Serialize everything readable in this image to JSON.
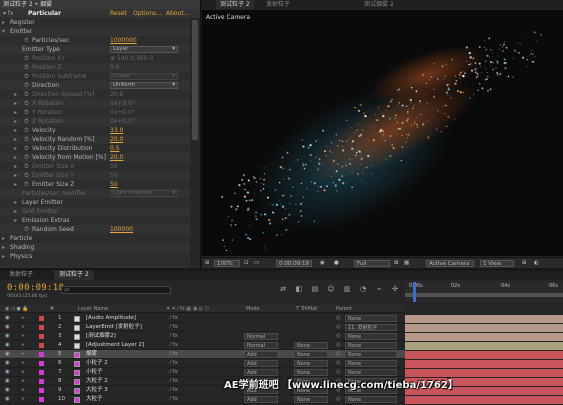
{
  "effect_controls": {
    "header": "测试粒子 2 • 烟雾",
    "effect_name": "Particular",
    "reset": "Reset",
    "options": "Options...",
    "about": "About...",
    "rows": [
      {
        "label": "Register",
        "indent": 1,
        "arrow": "▸"
      },
      {
        "label": "Emitter",
        "indent": 1,
        "arrow": "▾"
      },
      {
        "label": "Particles/sec",
        "indent": 2,
        "stopwatch": true,
        "value": "1000000"
      },
      {
        "label": "Emitter Type",
        "indent": 2,
        "dropdown": "Layer"
      },
      {
        "label": "Position XY",
        "indent": 2,
        "stopwatch": true,
        "value": "⊕ 540.0,360.0",
        "disabled": true
      },
      {
        "label": "Position Z",
        "indent": 2,
        "stopwatch": true,
        "value": "0.0",
        "disabled": true
      },
      {
        "label": "Position Subframe",
        "indent": 2,
        "stopwatch": true,
        "dropdown": "Linear",
        "disabled": true
      },
      {
        "label": "Direction",
        "indent": 2,
        "stopwatch": true,
        "dropdown": "Uniform"
      },
      {
        "label": "Direction Spread [%]",
        "indent": 2,
        "stopwatch": true,
        "arrow": "▸",
        "value": "20.0",
        "disabled": true
      },
      {
        "label": "X Rotation",
        "indent": 2,
        "stopwatch": true,
        "arrow": "▸",
        "value": "0x+0.0°",
        "disabled": true
      },
      {
        "label": "Y Rotation",
        "indent": 2,
        "stopwatch": true,
        "arrow": "▸",
        "value": "0x+0.0°",
        "disabled": true
      },
      {
        "label": "Z Rotation",
        "indent": 2,
        "stopwatch": true,
        "arrow": "▸",
        "value": "0x+0.0°",
        "disabled": true
      },
      {
        "label": "Velocity",
        "indent": 2,
        "stopwatch": true,
        "arrow": "▸",
        "value": "33.0"
      },
      {
        "label": "Velocity Random [%]",
        "indent": 2,
        "stopwatch": true,
        "arrow": "▸",
        "value": "20.0"
      },
      {
        "label": "Velocity Distribution",
        "indent": 2,
        "stopwatch": true,
        "arrow": "▸",
        "value": "0.5"
      },
      {
        "label": "Velocity from Motion [%]",
        "indent": 2,
        "stopwatch": true,
        "arrow": "▸",
        "value": "20.0"
      },
      {
        "label": "Emitter Size X",
        "indent": 2,
        "stopwatch": true,
        "arrow": "▸",
        "value": "50",
        "disabled": true
      },
      {
        "label": "Emitter Size Y",
        "indent": 2,
        "stopwatch": true,
        "arrow": "▸",
        "value": "50",
        "disabled": true
      },
      {
        "label": "Emitter Size Z",
        "indent": 2,
        "stopwatch": true,
        "arrow": "▸",
        "value": "50"
      },
      {
        "label": "Particles/sec modifier",
        "indent": 2,
        "dropdown": "Light Intensity",
        "disabled": true
      },
      {
        "label": "Layer Emitter",
        "indent": 2,
        "arrow": "▸"
      },
      {
        "label": "Grid Emitter",
        "indent": 2,
        "arrow": "▸",
        "disabled": true
      },
      {
        "label": "Emission Extras",
        "indent": 2,
        "arrow": "▸"
      },
      {
        "label": "Random Seed",
        "indent": 2,
        "stopwatch": true,
        "value": "100000"
      },
      {
        "label": "Particle",
        "indent": 1,
        "arrow": "▸"
      },
      {
        "label": "Shading",
        "indent": 1,
        "arrow": "▸"
      },
      {
        "label": "Physics",
        "indent": 1,
        "arrow": "▸"
      }
    ]
  },
  "viewer": {
    "tabs": [
      "测试粒子 2",
      "发射粒子",
      "测试烟雾 2"
    ],
    "camera_label": "Active Camera",
    "zoom": "100%",
    "timecode": "0:00:09:18",
    "resolution": "Full",
    "camera_select": "Active Camera",
    "view_select": "1 View"
  },
  "timeline": {
    "tabs": [
      "发射粒子",
      "测试粒子 2"
    ],
    "timecode": "0:00:09:18",
    "fps": "00243 (25.00 fps)",
    "search_placeholder": "ρ▾",
    "ruler_ticks": [
      "0:00s",
      "02s",
      "04s",
      "06s"
    ],
    "columns": {
      "layer_name": "Layer Name",
      "mode": "Mode",
      "trkmat": "T TrkMat",
      "parent": "Parent"
    },
    "layers": [
      {
        "num": "1",
        "name": "[Audio Amplitude]",
        "mode": "",
        "trk": "",
        "parent": "None",
        "label_color": "#c94a4a",
        "bar": "#b59a8c"
      },
      {
        "num": "2",
        "name": "LayerEmit [发射粒子]",
        "mode": "",
        "trk": "",
        "parent": "11. 发射粒子",
        "label_color": "#c94a4a",
        "bar": "#b59a8c"
      },
      {
        "num": "3",
        "name": "[测试烟雾2]",
        "mode": "Normal",
        "trk": "",
        "parent": "None",
        "label_color": "#c94a4a",
        "bar": "#b59a8c"
      },
      {
        "num": "4",
        "name": "[Adjustment Layer 2]",
        "mode": "Normal",
        "trk": "None",
        "parent": "None",
        "label_color": "#c94a4a",
        "bar": "#a9a27c"
      },
      {
        "num": "5",
        "name": "烟雾",
        "mode": "Add",
        "trk": "None",
        "parent": "None",
        "label_color": "#d83ad8",
        "bar": "#c8545c",
        "selected": true
      },
      {
        "num": "6",
        "name": "小粒子 2",
        "mode": "Add",
        "trk": "None",
        "parent": "None",
        "label_color": "#d83ad8",
        "bar": "#c8545c"
      },
      {
        "num": "7",
        "name": "小粒子",
        "mode": "Add",
        "trk": "None",
        "parent": "None",
        "label_color": "#d83ad8",
        "bar": "#c8545c"
      },
      {
        "num": "8",
        "name": "大粒子 2",
        "mode": "Add",
        "trk": "None",
        "parent": "None",
        "label_color": "#d83ad8",
        "bar": "#c8545c"
      },
      {
        "num": "9",
        "name": "大粒子 3",
        "mode": "Add",
        "trk": "None",
        "parent": "None",
        "label_color": "#d83ad8",
        "bar": "#c8545c"
      },
      {
        "num": "10",
        "name": "大粒子",
        "mode": "Add",
        "trk": "None",
        "parent": "None",
        "label_color": "#d83ad8",
        "bar": "#c8545c"
      }
    ]
  },
  "watermark": "AE学前班吧 【www.linecg.com/tieba/1762】",
  "colors": {
    "accent_orange": "#e4a53a",
    "playhead": "#3e6ec9",
    "bg_dark": "#1c1c1c"
  }
}
